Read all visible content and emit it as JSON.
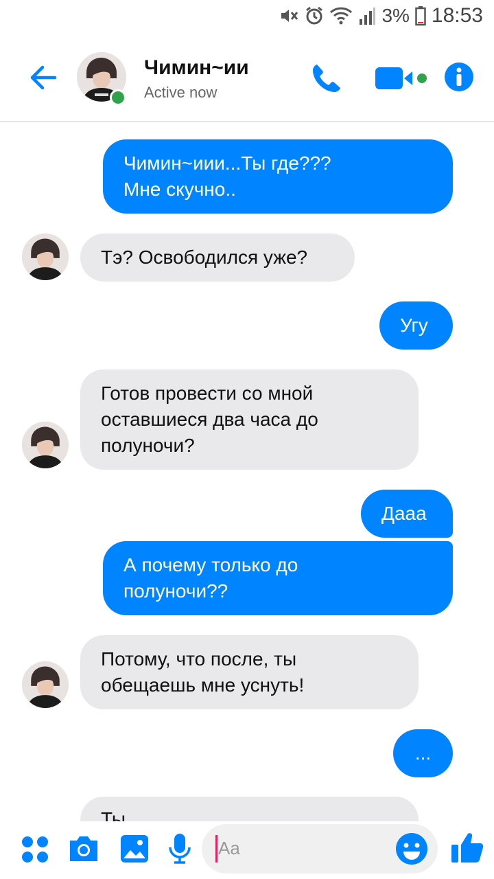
{
  "status_bar": {
    "battery_text": "3%",
    "time": "18:53"
  },
  "header": {
    "contact_name": "Чимин~ии",
    "contact_status": "Active now",
    "icons": [
      "back-arrow-icon",
      "phone-icon",
      "video-camera-icon",
      "info-icon"
    ],
    "accent_color": "#0084ff",
    "online_color": "#31a24c"
  },
  "messages": [
    {
      "direction": "out",
      "lines": [
        "Чимин~иии...Ты где???",
        "Мне скучно.."
      ]
    },
    {
      "direction": "in",
      "lines": [
        "Тэ? Освободился уже?"
      ]
    },
    {
      "direction": "out",
      "lines": [
        "Угу"
      ]
    },
    {
      "direction": "in",
      "lines": [
        "Готов провести со мной",
        "оставшиеся два часа до",
        "полуночи?"
      ]
    },
    {
      "direction": "out",
      "lines": [
        "Дааа"
      ]
    },
    {
      "direction": "out",
      "lines": [
        "А почему только до",
        "полуночи??"
      ]
    },
    {
      "direction": "in",
      "lines": [
        "Потому, что после, ты",
        "обещаешь мне уснуть!"
      ]
    },
    {
      "direction": "out",
      "lines": [
        "..."
      ]
    },
    {
      "direction": "in",
      "lines": [
        "Ты"
      ]
    }
  ],
  "composer": {
    "placeholder": "Aa",
    "icons": [
      "apps-icon",
      "camera-icon",
      "image-icon",
      "microphone-icon",
      "emoji-icon",
      "like-icon"
    ]
  }
}
